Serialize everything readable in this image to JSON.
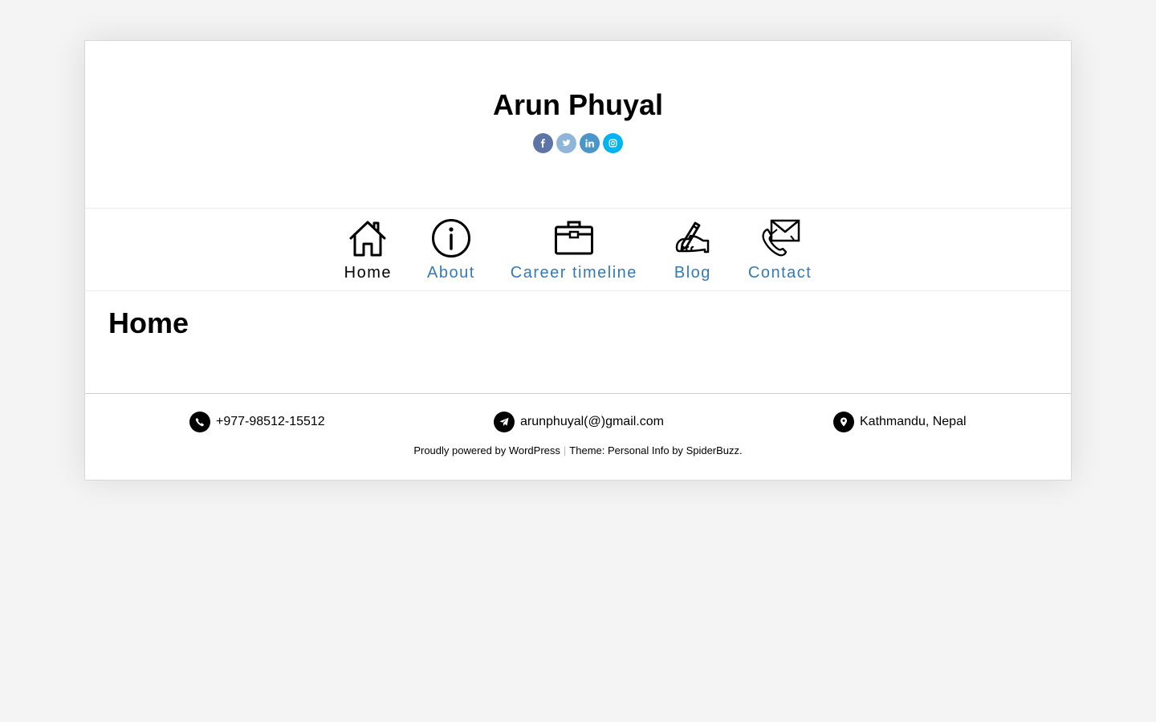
{
  "header": {
    "site_title": "Arun Phuyal",
    "social": [
      {
        "name": "facebook-icon",
        "color": "#5d74a6"
      },
      {
        "name": "twitter-icon",
        "color": "#8fb6d8"
      },
      {
        "name": "linkedin-icon",
        "color": "#4a96c9"
      },
      {
        "name": "instagram-icon",
        "color": "#00b4ef"
      }
    ]
  },
  "nav": {
    "items": [
      {
        "label": "Home",
        "icon": "house-icon",
        "active": true
      },
      {
        "label": "About",
        "icon": "info-icon",
        "active": false
      },
      {
        "label": "Career timeline",
        "icon": "briefcase-icon",
        "active": false
      },
      {
        "label": "Blog",
        "icon": "writing-hand-icon",
        "active": false
      },
      {
        "label": "Contact",
        "icon": "phone-envelope-icon",
        "active": false
      }
    ],
    "link_color": "#337ab7"
  },
  "main": {
    "title": "Home"
  },
  "footer": {
    "phone": "+977-98512-15512",
    "email": "arunphuyal(@)gmail.com",
    "location": "Kathmandu, Nepal",
    "powered_by": "Proudly powered by WordPress",
    "separator": "|",
    "theme_prefix": "Theme: Personal Info by",
    "theme_author": "SpiderBuzz."
  }
}
